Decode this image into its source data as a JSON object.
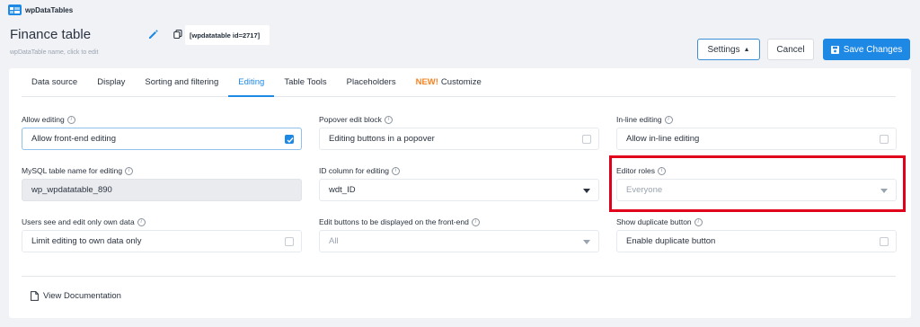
{
  "brand": {
    "name": "wpDataTables",
    "logo_icon": "wpdatatables-logo-icon"
  },
  "header": {
    "title": "Finance table",
    "subtitle": "wpDataTable name, click to edit",
    "shortcode": "[wpdatatable id=2717]",
    "settings_label": "Settings",
    "cancel_label": "Cancel",
    "save_label": "Save Changes"
  },
  "tabs": [
    {
      "label": "Data source",
      "active": false
    },
    {
      "label": "Display",
      "active": false
    },
    {
      "label": "Sorting and filtering",
      "active": false
    },
    {
      "label": "Editing",
      "active": true
    },
    {
      "label": "Table Tools",
      "active": false
    },
    {
      "label": "Placeholders",
      "active": false
    },
    {
      "badge": "NEW!",
      "label": "Customize",
      "active": false
    }
  ],
  "fields": {
    "allow_editing": {
      "label": "Allow editing",
      "value": "Allow front-end editing",
      "checked": true
    },
    "popover_edit": {
      "label": "Popover edit block",
      "value": "Editing buttons in a popover",
      "checked": false
    },
    "inline_editing": {
      "label": "In-line editing",
      "value": "Allow in-line editing",
      "checked": false
    },
    "mysql_table": {
      "label": "MySQL table name for editing",
      "value": "wp_wpdatatable_890"
    },
    "id_column": {
      "label": "ID column for editing",
      "value": "wdt_ID"
    },
    "editor_roles": {
      "label": "Editor roles",
      "placeholder": "Everyone"
    },
    "own_data": {
      "label": "Users see and edit only own data",
      "value": "Limit editing to own data only",
      "checked": false
    },
    "edit_buttons": {
      "label": "Edit buttons to be displayed on the front-end",
      "placeholder": "All"
    },
    "duplicate": {
      "label": "Show duplicate button",
      "value": "Enable duplicate button",
      "checked": false
    }
  },
  "footer": {
    "doc_link": "View Documentation"
  },
  "colors": {
    "accent": "#1e88e5",
    "highlight": "#e0001b",
    "badge": "#f58220"
  }
}
